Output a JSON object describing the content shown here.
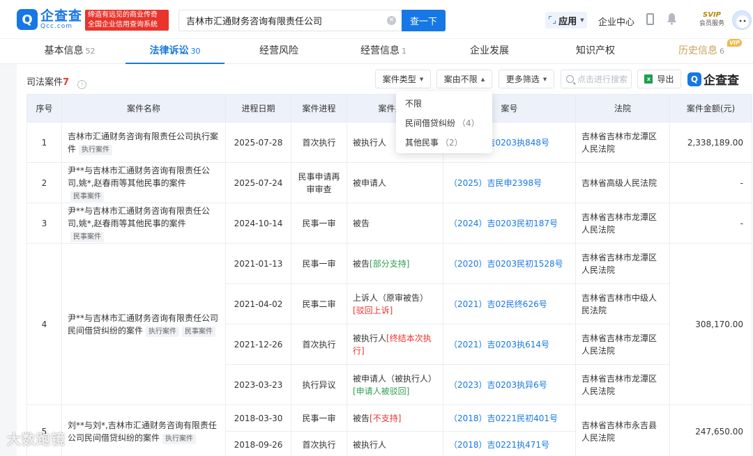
{
  "header": {
    "logo_cn": "企查查",
    "logo_en": "Qcc.com",
    "logo_mark": "Q",
    "slogan_line1": "缔造有远见的商业传奇",
    "slogan_line2": "全国企业信用查询系统",
    "search_value": "吉林市汇通财务咨询有限责任公司",
    "search_button": "查一下",
    "app_label": "应用",
    "enterprise_center": "企业中心",
    "svip_top": "SVIP",
    "svip_bottom": "会员服务"
  },
  "tabs": [
    {
      "label": "基本信息",
      "count": "52"
    },
    {
      "label": "法律诉讼",
      "count": "30"
    },
    {
      "label": "经营风险",
      "count": ""
    },
    {
      "label": "经营信息",
      "count": "1"
    },
    {
      "label": "企业发展",
      "count": ""
    },
    {
      "label": "知识产权",
      "count": ""
    },
    {
      "label": "历史信息",
      "count": "6",
      "badge": "VIP"
    }
  ],
  "section": {
    "title": "司法案件",
    "count": "7",
    "filters": [
      "案件类型",
      "案由不限",
      "更多筛选"
    ],
    "search_placeholder": "点击进行搜索",
    "export_label": "导出",
    "export_icon_text": "x",
    "brand_text": "企查查",
    "brand_mark": "Q"
  },
  "table": {
    "headers": [
      "序号",
      "案件名称",
      "进程日期",
      "案件进程",
      "案件身份",
      "案号",
      "法院",
      "案件金额(元)"
    ],
    "rows": [
      {
        "no": "1",
        "name": "吉林市汇通财务咨询有限责任公司执行案件",
        "tags": [
          "执行案件"
        ],
        "date": "2025-07-28",
        "stage": "首次执行",
        "role": "被执行人",
        "case_no": "（2025）吉0203执848号",
        "court": "吉林省吉林市龙潭区人民法院",
        "amount": "2,338,189.00"
      },
      {
        "no": "2",
        "name": "尹**与吉林市汇通财务咨询有限责任公司,姚*,赵春雨等其他民事的案件",
        "tags": [
          "民事案件"
        ],
        "date": "2025-07-24",
        "stage": "民事申请再审审查",
        "role": "被申请人",
        "case_no": "（2025）吉民申2398号",
        "court": "吉林省高级人民法院",
        "amount": "-"
      },
      {
        "no": "3",
        "name": "尹**与吉林市汇通财务咨询有限责任公司,姚*,赵春雨等其他民事的案件",
        "tags": [
          "民事案件"
        ],
        "date": "2024-10-14",
        "stage": "民事一审",
        "role": "被告",
        "case_no": "（2024）吉0203民初187号",
        "court": "吉林省吉林市龙潭区人民法院",
        "amount": "-"
      },
      {
        "no": "4",
        "name": "尹**与吉林市汇通财务咨询有限责任公司民间借贷纠纷的案件",
        "tags": [
          "执行案件",
          "民事案件"
        ],
        "amount": "308,170.00",
        "sub": [
          {
            "date": "2021-01-13",
            "stage": "民事一审",
            "role": "被告",
            "role_note": "[部分支持]",
            "note_color": "green",
            "case_no": "（2020）吉0203民初1528号",
            "court": "吉林省吉林市龙潭区人民法院"
          },
          {
            "date": "2021-04-02",
            "stage": "民事二审",
            "role": "上诉人（原审被告）",
            "role_note": "[驳回上诉]",
            "note_color": "red",
            "case_no": "（2021）吉02民终626号",
            "court": "吉林省吉林市中级人民法院"
          },
          {
            "date": "2021-12-26",
            "stage": "首次执行",
            "role": "被执行人",
            "role_note": "[终结本次执行]",
            "note_color": "red",
            "case_no": "（2021）吉0203执614号",
            "court": "吉林省吉林市龙潭区人民法院"
          },
          {
            "date": "2023-03-23",
            "stage": "执行异议",
            "role": "被申请人（被执行人）",
            "role_note": "[申请人被驳回]",
            "note_color": "green",
            "case_no": "（2023）吉0203执异6号",
            "court": "吉林省吉林市龙潭区人民法院"
          }
        ]
      },
      {
        "no": "5",
        "name": "刘**与刘*,吉林市汇通财务咨询有限责任公司民间借贷纠纷的案件",
        "tags": [
          "执行案件"
        ],
        "amount": "247,650.00",
        "court": "吉林省吉林市永吉县人民法院",
        "sub": [
          {
            "date": "2018-03-30",
            "stage": "民事一审",
            "role": "被告",
            "role_note": "[不支持]",
            "note_color": "red",
            "case_no": "（2018）吉0221民初401号"
          },
          {
            "date": "2018-09-26",
            "stage": "首次执行",
            "role": "被执行人",
            "role_note": "",
            "note_color": "",
            "case_no": "（2018）吉0221执471号"
          }
        ]
      }
    ]
  },
  "dropdown": {
    "options": [
      {
        "label": "不限",
        "count": ""
      },
      {
        "label": "民间借贷纠纷",
        "count": "（4）"
      },
      {
        "label": "其他民事",
        "count": "（2）"
      }
    ]
  },
  "watermark": "大数跑镜"
}
